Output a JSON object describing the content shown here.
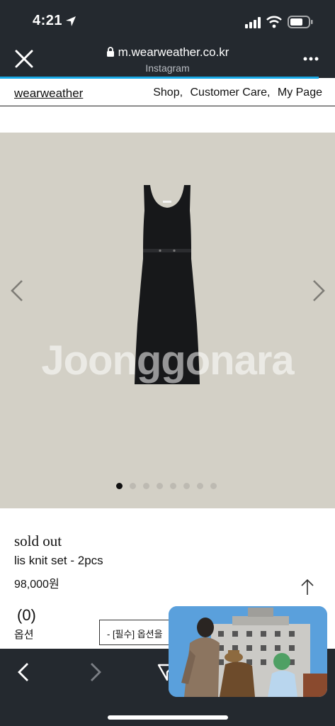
{
  "status_bar": {
    "time": "4:21"
  },
  "browser": {
    "url": "m.wearweather.co.kr",
    "subtitle": "Instagram"
  },
  "site_nav": {
    "brand": "wearweather",
    "links": [
      "Shop,",
      "Customer Care,",
      "My Page"
    ]
  },
  "gallery": {
    "watermark": "Joonggonara",
    "dot_count": 8,
    "active_dot": 0
  },
  "product": {
    "status": "sold out",
    "name": "lis knit set - 2pcs",
    "price": "98,000원",
    "count": "(0)",
    "option_label": "옵션",
    "option_select": "- [필수] 옵션을"
  },
  "colors": {
    "chrome": "#24292f",
    "accent": "#18a9e6",
    "gallery_bg": "#d3d0c6"
  }
}
